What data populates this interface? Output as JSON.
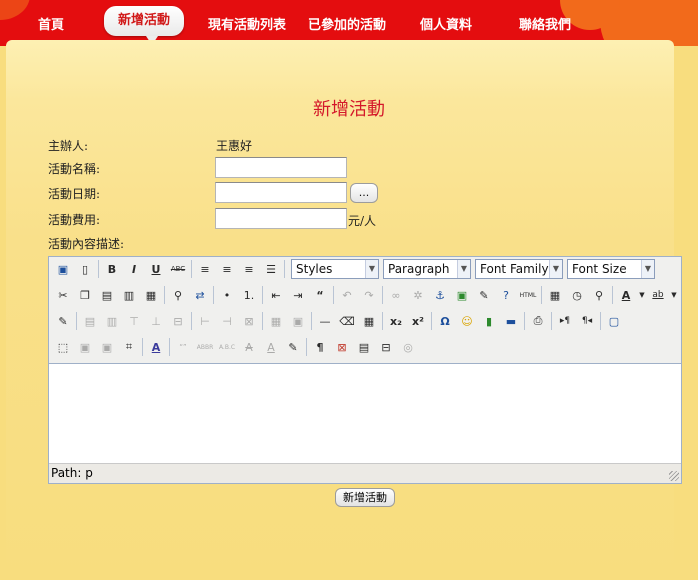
{
  "nav": {
    "items": [
      {
        "label": "首頁"
      },
      {
        "label": "新增活動"
      },
      {
        "label": "現有活動列表"
      },
      {
        "label": "已參加的活動"
      },
      {
        "label": "個人資料"
      },
      {
        "label": "聯絡我們"
      }
    ],
    "active_index": 1
  },
  "form": {
    "title": "新增活動",
    "organizer_label": "主辦人:",
    "organizer_value": "王惠好",
    "name_label": "活動名稱:",
    "name_value": "",
    "date_label": "活動日期:",
    "date_value": "",
    "date_picker_label": "...",
    "fee_label": "活動費用:",
    "fee_value": "",
    "fee_unit": "元/人",
    "content_label": "活動內容描述:",
    "submit_label": "新增活動"
  },
  "editor": {
    "styles_select": "Styles",
    "format_select": "Paragraph",
    "font_family_select": "Font Family",
    "font_size_select": "Font Size",
    "status_path": "Path: p",
    "body_text": ""
  },
  "colors": {
    "header_red": "#e40d0f",
    "header_orange": "#f26a1b",
    "page_background": "#f8dd7e",
    "title_red": "#d4182a"
  }
}
